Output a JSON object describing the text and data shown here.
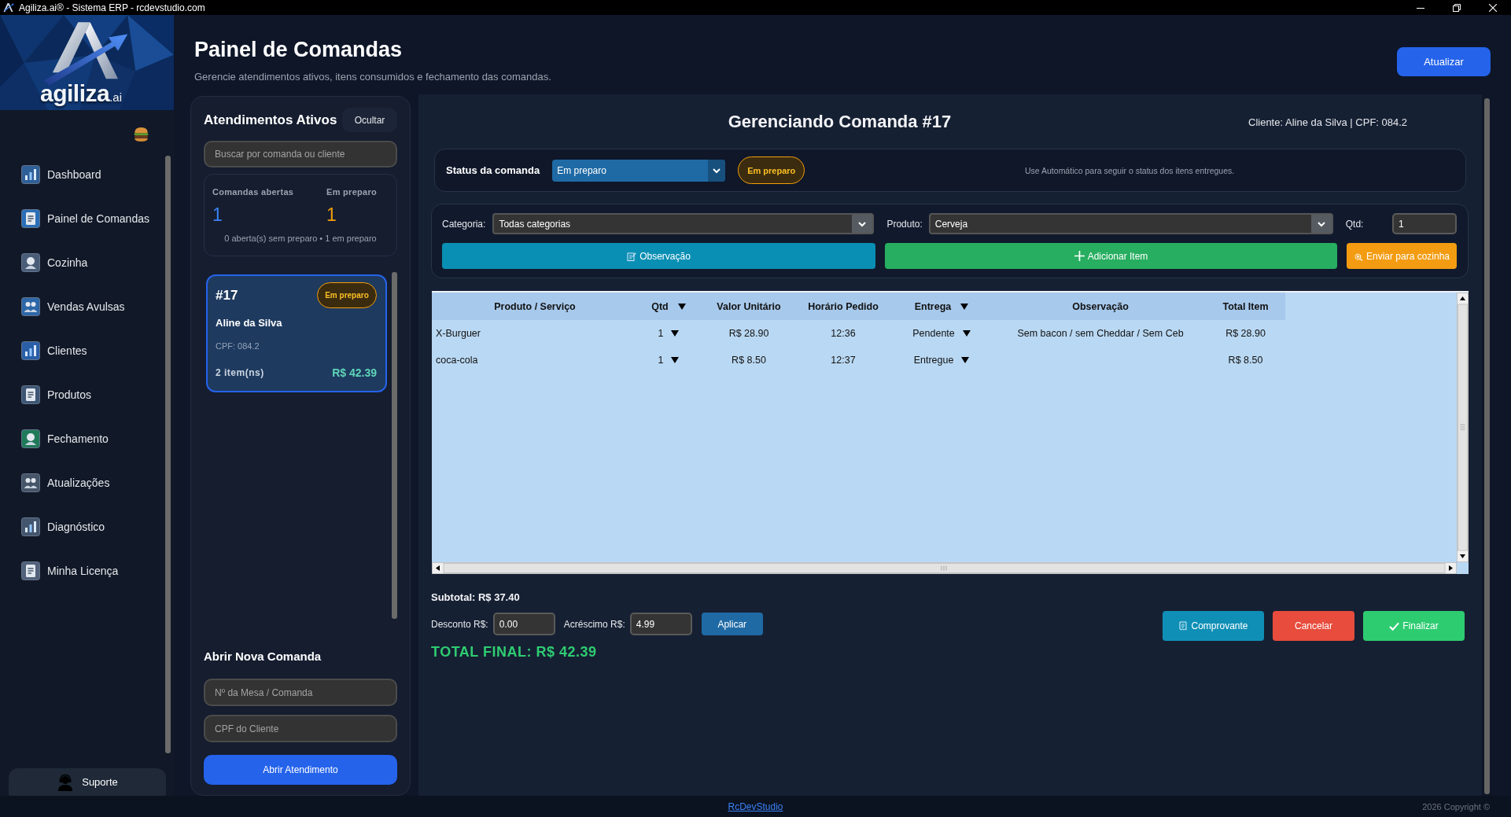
{
  "window": {
    "title": "Agiliza.ai® - Sistema ERP - rcdevstudio.com"
  },
  "sidebar": {
    "logo": {
      "wordmark": "agiliza",
      "suffix": ".ai"
    },
    "items": [
      {
        "label": "Dashboard"
      },
      {
        "label": "Painel de Comandas"
      },
      {
        "label": "Cozinha"
      },
      {
        "label": "Vendas Avulsas"
      },
      {
        "label": "Clientes"
      },
      {
        "label": "Produtos"
      },
      {
        "label": "Fechamento"
      },
      {
        "label": "Atualizações"
      },
      {
        "label": "Diagnóstico"
      },
      {
        "label": "Minha Licença"
      }
    ],
    "support_button": "Suporte"
  },
  "header": {
    "title": "Painel de Comandas",
    "subtitle": "Gerencie atendimentos ativos, itens consumidos e fechamento das comandas.",
    "refresh_button": "Atualizar"
  },
  "active_panel": {
    "title": "Atendimentos Ativos",
    "hide_button": "Ocultar",
    "search": {
      "placeholder": "Buscar por comanda ou cliente"
    },
    "stats": [
      {
        "label": "Comandas abertas",
        "value": "1",
        "color": "#3b82f6"
      },
      {
        "label": "Em preparo",
        "value": "1",
        "color": "#f59e0b"
      }
    ],
    "stats_note": "0 aberta(s) sem preparo • 1 em preparo",
    "orders": [
      {
        "number": "#17",
        "status": "Em preparo",
        "client": "Aline da Silva",
        "cpf": "CPF: 084.2",
        "items": "2 item(ns)",
        "total": "R$ 42.39",
        "selected": true
      }
    ],
    "new_order": {
      "title": "Abrir Nova Comanda",
      "fields": [
        {
          "placeholder": "Nº da Mesa / Comanda"
        },
        {
          "placeholder": "CPF do Cliente"
        }
      ],
      "button": "Abrir Atendimento"
    }
  },
  "manage_panel": {
    "title": "Gerenciando Comanda #17",
    "client_info": "Cliente: Aline da Silva | CPF: 084.2",
    "status": {
      "label": "Status da comanda",
      "value": "Em preparo",
      "badge": "Em preparo",
      "hint": "Use Automático para seguir o status dos itens entregues."
    },
    "add_item": {
      "category_label": "Categoria:",
      "category_value": "Todas categorias",
      "product_label": "Produto:",
      "product_value": "Cerveja",
      "qty_label": "Qtd:",
      "qty_value": "1",
      "buttons": [
        {
          "label": "Observação",
          "kind": "note"
        },
        {
          "label": "Adicionar Item",
          "kind": "add"
        },
        {
          "label": "Enviar para cozinha",
          "kind": "kitchen"
        }
      ]
    },
    "table": {
      "columns": [
        {
          "label": "Produto / Serviço",
          "kind": "text"
        },
        {
          "label": "Qtd",
          "kind": "dropdown"
        },
        {
          "label": "Valor Unitário",
          "kind": "text"
        },
        {
          "label": "Horário Pedido",
          "kind": "text"
        },
        {
          "label": "Entrega",
          "kind": "dropdown"
        },
        {
          "label": "Observação",
          "kind": "text"
        },
        {
          "label": "Total Item",
          "kind": "text"
        }
      ],
      "rows": [
        {
          "product": "X-Burguer",
          "qty": "1",
          "unit_price": "R$ 28.90",
          "time": "12:36",
          "delivery": "Pendente",
          "note": "Sem bacon / sem Cheddar / Sem Ceb",
          "total": "R$ 28.90"
        },
        {
          "product": "coca-cola",
          "qty": "1",
          "unit_price": "R$ 8.50",
          "time": "12:37",
          "delivery": "Entregue",
          "total": "R$ 8.50"
        }
      ]
    },
    "totals": {
      "subtotal": "Subtotal: R$ 37.40",
      "discount_label": "Desconto R$:",
      "discount_value": "0.00",
      "surcharge_label": "Acréscimo R$:",
      "surcharge_value": "4.99",
      "apply_button": "Aplicar",
      "total": "TOTAL FINAL: R$ 42.39"
    },
    "actions": [
      {
        "label": "Comprovante",
        "kind": "receipt"
      },
      {
        "label": "Cancelar",
        "kind": "cancel"
      },
      {
        "label": "Finalizar",
        "kind": "finish"
      }
    ]
  },
  "footer": {
    "link": "RcDevStudio",
    "copyright": "2026 Copyright ©"
  }
}
